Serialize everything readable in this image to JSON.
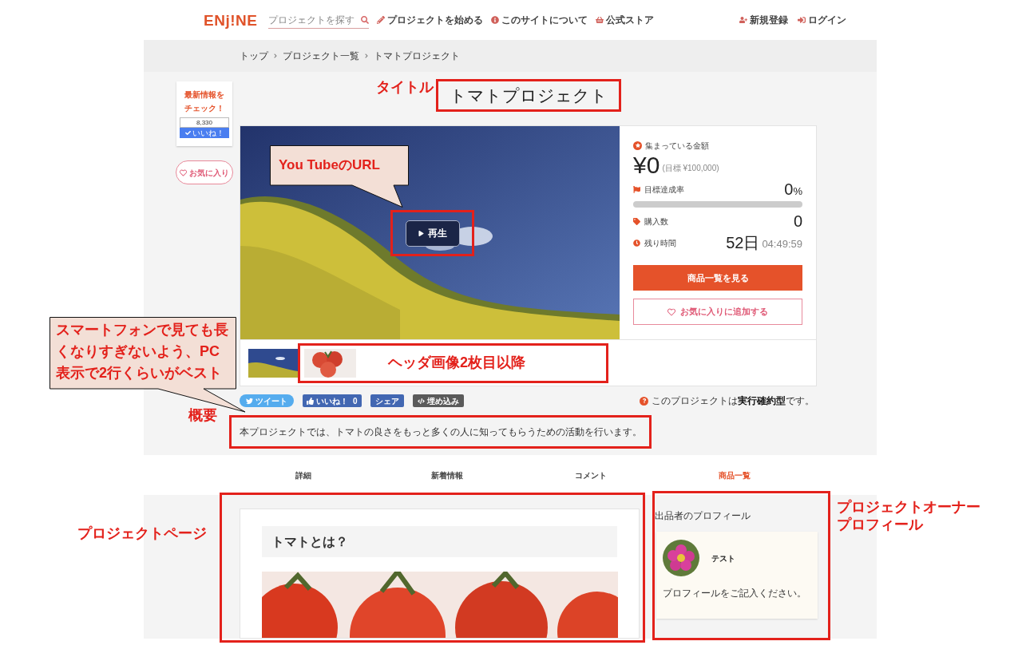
{
  "header": {
    "logo": "ENj!NE",
    "search": {
      "placeholder": "プロジェクトを探す"
    },
    "nav": [
      {
        "label": "プロジェクトを始める"
      },
      {
        "label": "このサイトについて"
      },
      {
        "label": "公式ストア"
      }
    ],
    "account": [
      {
        "label": "新規登録"
      },
      {
        "label": "ログイン"
      }
    ]
  },
  "breadcrumb": [
    "トップ",
    "プロジェクト一覧",
    "トマトプロジェクト"
  ],
  "sidebar": {
    "news_prompt": "最新情報をチェック！",
    "like_count": "8,330",
    "like_button": "いいね！",
    "favorite_button": "お気に入り"
  },
  "title": "トマトプロジェクト",
  "video": {
    "play_button": "再生"
  },
  "thumbnails": [
    {
      "kind": "landscape"
    },
    {
      "kind": "tomato"
    }
  ],
  "stats": {
    "funding": {
      "label": "集まっている金額",
      "amount": "¥0",
      "goal": "(目標 ¥100,000)"
    },
    "achievement": {
      "label": "目標達成率",
      "value": "0",
      "unit": "%",
      "level": 0
    },
    "purchases": {
      "label": "購入数",
      "value": "0"
    },
    "time_left": {
      "label": "残り時間",
      "days": "52日",
      "clock": "04:49:59"
    },
    "primary_button": "商品一覧を見る",
    "favorite_button": "お気に入りに追加する"
  },
  "share_buttons": [
    {
      "kind": "tweet",
      "label": "ツイート"
    },
    {
      "kind": "like",
      "label": "いいね！",
      "count": "0"
    },
    {
      "kind": "share",
      "label": "シェア"
    },
    {
      "kind": "embed",
      "label": "埋め込み"
    }
  ],
  "project_type_note": "このプロジェクトは**実行確約型**です。",
  "summary": "本プロジェクトでは、トマトの良さをもっと多くの人に知ってもらうための活動を行います。",
  "tabs": [
    {
      "label": "詳細",
      "selected": false
    },
    {
      "label": "新着情報",
      "selected": false
    },
    {
      "label": "コメント",
      "selected": false
    },
    {
      "label": "商品一覧",
      "selected": true
    }
  ],
  "content": {
    "heading": "トマトとは？"
  },
  "owner_profile": {
    "heading": "出品者のプロフィール",
    "name": "テスト",
    "bio": "プロフィールをご記入ください。"
  },
  "annotations": {
    "title_label": "タイトル",
    "video_callout": "You TubeのURL",
    "thumbnails_note": "ヘッダ画像2枚目以降",
    "summary_callout": "スマートフォンで見ても長くなりすぎないよう、PC表示で2行くらいがベスト",
    "summary_label": "概要",
    "page_label": "プロジェクトページ",
    "owner_label": "プロジェクトオーナープロフィール"
  }
}
